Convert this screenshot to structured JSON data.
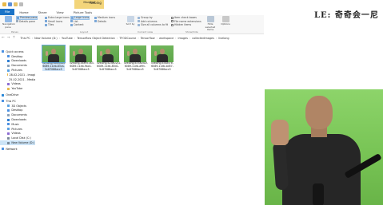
{
  "window": {
    "manage_label": "Manage",
    "title": "fcebing",
    "watermark": "LE: 奇奇会一尼"
  },
  "ribbon_tabs": [
    "File",
    "Home",
    "Share",
    "View",
    "Picture Tools"
  ],
  "ribbon": {
    "panes_group": [
      "Navigation pane",
      "Preview pane",
      "Details pane"
    ],
    "layout": {
      "col1": [
        "Extra large icons",
        "Small icons",
        "Tiles"
      ],
      "col2": [
        "Large icons",
        "List",
        "Content"
      ],
      "col3": [
        "Medium icons",
        "Details"
      ]
    },
    "sort_label": "Sort by",
    "current_view": [
      "Group by",
      "Add columns",
      "Size all columns to fit"
    ],
    "current_view_label": "Current view",
    "show_hide": [
      "Item check boxes",
      "File name extensions",
      "Hidden items"
    ],
    "hide_selected": "Hide selected items",
    "options": "Options",
    "show_hide_label": "Show/hide",
    "layout_label": "Layout",
    "panes_label": "Panes"
  },
  "address": {
    "path": [
      "This PC",
      "New Volume (D:)",
      "YouTube",
      "Tensorflow Object Detection",
      "TFODCourse",
      "Tensorflow",
      "workspace",
      "images",
      "collectedimages",
      "livelong"
    ]
  },
  "nav": {
    "quick_access": "Quick access",
    "quick_items": [
      "Desktop",
      "Downloads",
      "Documents",
      "Pictures",
      "28-02-2021 - Imagi",
      "25-02-2021 - Media",
      "Videos",
      "YouTube"
    ],
    "onedrive": "OneDrive",
    "this_pc": "This PC",
    "pc_items": [
      "3D Objects",
      "Desktop",
      "Documents",
      "Downloads",
      "Music",
      "Pictures",
      "Videos",
      "Local Disk (C:)",
      "New Volume (D:)"
    ],
    "network": "Network"
  },
  "files": [
    {
      "name": "livelong.38df5a0f-6089-11eb-83ca-5c87086acc5",
      "selected": true
    },
    {
      "name": "livelong.58e953a3-6089-11eb-9ac4-5c87086acc5",
      "selected": false
    },
    {
      "name": "livelong.62de02c2-6089-11eb-85d1-5c87086acc5",
      "selected": false
    },
    {
      "name": "livelong.635a0d2f-6089-11eb-a9fc-5c87086acc5",
      "selected": false
    },
    {
      "name": "livelong.6584f7e-6089-11eb-bd57-5c87086acc5",
      "selected": false
    }
  ],
  "colors": {
    "file_tab": "#1a73c7",
    "manage_tab": "#f3d57a",
    "selection": "#cce4f7",
    "greenscreen": "#78c455"
  }
}
